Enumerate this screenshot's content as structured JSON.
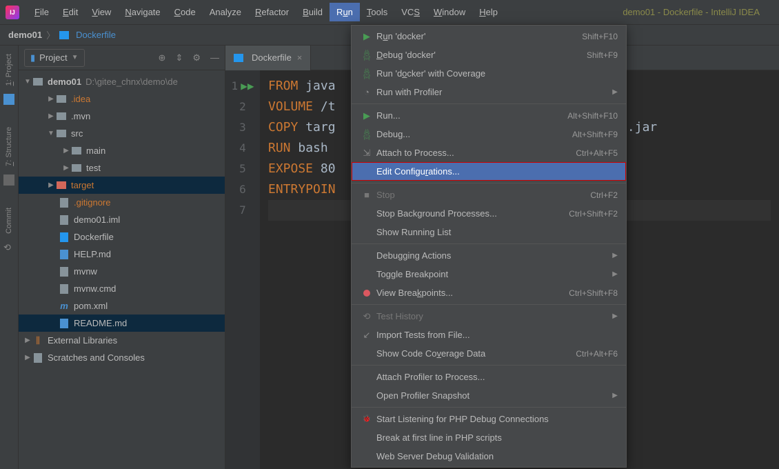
{
  "window_title": "demo01 - Dockerfile - IntelliJ IDEA",
  "menubar": {
    "file": "File",
    "edit": "Edit",
    "view": "View",
    "navigate": "Navigate",
    "code": "Code",
    "analyze": "Analyze",
    "refactor": "Refactor",
    "build": "Build",
    "run": "Run",
    "tools": "Tools",
    "vcs": "VCS",
    "window": "Window",
    "help": "Help"
  },
  "breadcrumb": {
    "project": "demo01",
    "file": "Dockerfile"
  },
  "left_gutter": {
    "project": "1: Project",
    "structure": "7: Structure",
    "commit": "Commit"
  },
  "sidebar": {
    "header": "Project",
    "root": "demo01",
    "root_path": "D:\\gitee_chnx\\demo\\de",
    "items": [
      ".idea",
      ".mvn",
      "src",
      "main",
      "test",
      "target",
      ".gitignore",
      "demo01.iml",
      "Dockerfile",
      "HELP.md",
      "mvnw",
      "mvnw.cmd",
      "pom.xml",
      "README.md"
    ],
    "external": "External Libraries",
    "scratches": "Scratches and Consoles"
  },
  "tab": {
    "label": "Dockerfile"
  },
  "code": {
    "l1_kw": "FROM",
    "l1_rest": " java",
    "l2_kw": "VOLUME",
    "l2_rest": " /t",
    "l3_kw": "COPY",
    "l3_rest": " targ",
    "l4_kw": "RUN",
    "l4_rest": " bash",
    "l5_kw": "EXPOSE",
    "l5_rest": " 80",
    "l6_kw": "ENTRYPOIN",
    "frag": "urce.jar"
  },
  "dropdown": [
    {
      "icon": "play",
      "label": "Run 'docker'",
      "u": "u",
      "shortcut": "Shift+F10"
    },
    {
      "icon": "bug",
      "label": "Debug 'docker'",
      "u": "D",
      "shortcut": "Shift+F9"
    },
    {
      "icon": "bugplay",
      "label": "Run 'docker' with Coverage",
      "u": "o"
    },
    {
      "icon": "clock",
      "label": "Run with Profiler",
      "arrow": true
    },
    {
      "sep": true
    },
    {
      "icon": "play",
      "label": "Run...",
      "shortcut": "Alt+Shift+F10"
    },
    {
      "icon": "bug",
      "label": "Debug...",
      "shortcut": "Alt+Shift+F9"
    },
    {
      "icon": "attach",
      "label": "Attach to Process...",
      "shortcut": "Ctrl+Alt+F5"
    },
    {
      "label": "Edit Configurations...",
      "u": "r",
      "highlighted": true
    },
    {
      "sep": true
    },
    {
      "icon": "stop",
      "label": "Stop",
      "shortcut": "Ctrl+F2",
      "disabled": true
    },
    {
      "label": "Stop Background Processes...",
      "shortcut": "Ctrl+Shift+F2"
    },
    {
      "label": "Show Running List"
    },
    {
      "sep": true
    },
    {
      "label": "Debugging Actions",
      "arrow": true
    },
    {
      "label": "Toggle Breakpoint",
      "arrow": true
    },
    {
      "icon": "bp",
      "label": "View Breakpoints...",
      "u": "k",
      "shortcut": "Ctrl+Shift+F8"
    },
    {
      "sep": true
    },
    {
      "icon": "history",
      "label": "Test History",
      "arrow": true,
      "disabled": true
    },
    {
      "icon": "import",
      "label": "Import Tests from File..."
    },
    {
      "label": "Show Code Coverage Data",
      "u": "v",
      "shortcut": "Ctrl+Alt+F6"
    },
    {
      "sep": true
    },
    {
      "label": "Attach Profiler to Process..."
    },
    {
      "label": "Open Profiler Snapshot",
      "arrow": true
    },
    {
      "sep": true
    },
    {
      "icon": "php",
      "label": "Start Listening for PHP Debug Connections"
    },
    {
      "label": "Break at first line in PHP scripts"
    },
    {
      "label": "Web Server Debug Validation"
    }
  ]
}
